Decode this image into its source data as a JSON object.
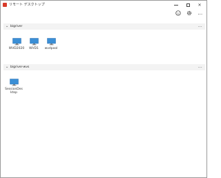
{
  "window": {
    "title": "リモート デスクトップ",
    "minimize": "–",
    "maximize": "□",
    "close": "✕"
  },
  "toolbar": {
    "more_label": "…"
  },
  "groups": [
    {
      "label": "bigriver",
      "more_label": "…",
      "items": [
        {
          "label": "WVD2020"
        },
        {
          "label": "WVD1"
        },
        {
          "label": "wvdpool"
        }
      ]
    },
    {
      "label": "bigriver-wvs",
      "more_label": "…",
      "items": [
        {
          "label_line1": "SessionDes",
          "label_line2": "ktop"
        }
      ]
    }
  ],
  "colors": {
    "app_icon": "#d83b2a",
    "monitor_screen": "#3b8fd6",
    "group_header_bg": "#f3f3f3"
  },
  "icons": {
    "app": "remote-desktop-icon",
    "user": "smiley-icon",
    "settings": "gear-icon",
    "more": "ellipsis-icon",
    "tile": "monitor-icon"
  }
}
